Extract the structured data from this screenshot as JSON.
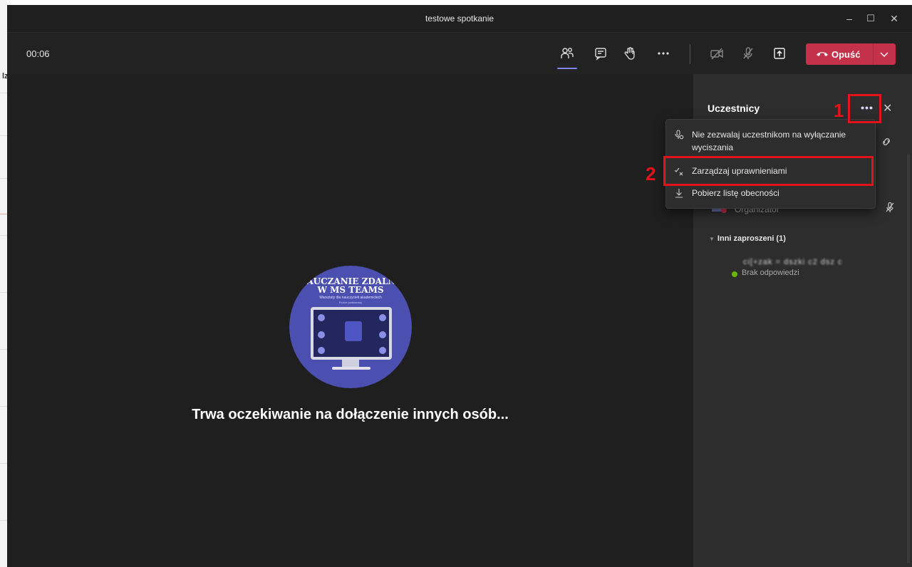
{
  "window": {
    "title": "testowe spotkanie",
    "controls": {
      "minimize": "–",
      "maximize": "☐",
      "close": "✕"
    }
  },
  "background_app": {
    "letter": "lz"
  },
  "toolbar": {
    "timer": "00:06",
    "icons": [
      "participants-icon",
      "chat-icon",
      "raise-hand-icon",
      "more-actions-icon",
      "camera-off-icon",
      "mic-off-icon",
      "share-tray-icon"
    ],
    "leave_label": "Opuść",
    "colors": {
      "leave": "#c4314b",
      "active_underline": "#7f85f5"
    }
  },
  "stage": {
    "poster": {
      "line1": "NAUCZANIE ZDALNE",
      "line2": "W MS TEAMS",
      "line3": "Warsztaty dla nauczycieli akademickich",
      "line4": "Poziom podstawowy"
    },
    "waiting_text": "Trwa oczekiwanie na dołączenie innych osób..."
  },
  "panel": {
    "title": "Uczestnicy",
    "organizer_role": "Organizator",
    "section_title": "Inni zaproszeni (1)",
    "invitee_name": "ci[+zak  = dszki  c2  dsz  c",
    "invitee_status": "Brak odpowiedzi"
  },
  "menu": {
    "items": [
      {
        "label": "Nie zezwalaj uczestnikom na wyłączanie wyciszania",
        "icon": "mic-lock-icon"
      },
      {
        "label": "Zarządzaj uprawnieniami",
        "icon": "permissions-icon"
      },
      {
        "label": "Pobierz listę obecności",
        "icon": "download-icon"
      }
    ]
  },
  "annotations": {
    "step1": "1",
    "step2": "2",
    "color": "#e3131b"
  }
}
